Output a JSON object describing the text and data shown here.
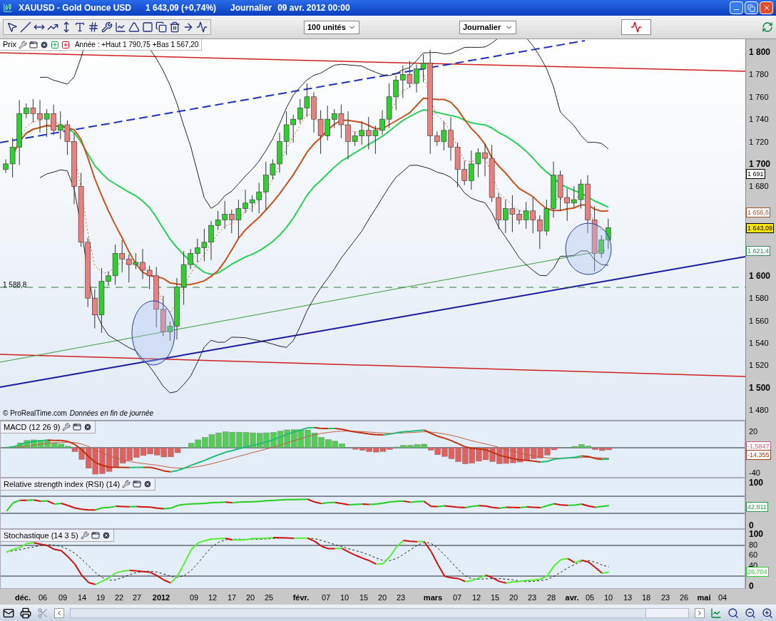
{
  "window": {
    "symbol": "XAUUSD - Gold Ounce USD",
    "quote": "1 643,09 (+0,74%)",
    "interval": "Journalier",
    "date": "09 avr. 2012 00:00"
  },
  "toolbar": {
    "quantity": "100 unités",
    "timeframe": "Journalier"
  },
  "price_panel": {
    "label": "Prix",
    "info": "Année : +Haut 1 790,75 +Bas 1 567,20",
    "level_label": "1 588,8",
    "credit": "© ProRealTime.com",
    "credit_note": "Données en fin de journée",
    "axis": [
      {
        "label": "1 800",
        "kind": "major"
      },
      {
        "label": "1 780",
        "kind": "minor"
      },
      {
        "label": "1 760",
        "kind": "minor"
      },
      {
        "label": "1 740",
        "kind": "minor"
      },
      {
        "label": "1 720",
        "kind": "minor"
      },
      {
        "label": "1 700",
        "kind": "major"
      },
      {
        "label": "1 680",
        "kind": "minor"
      },
      {
        "label": "1 600",
        "kind": "major"
      },
      {
        "label": "1 580",
        "kind": "minor"
      },
      {
        "label": "1 560",
        "kind": "minor"
      },
      {
        "label": "1 540",
        "kind": "minor"
      },
      {
        "label": "1 520",
        "kind": "minor"
      },
      {
        "label": "1 500",
        "kind": "major"
      },
      {
        "label": "1 480",
        "kind": "minor"
      }
    ],
    "markers": [
      {
        "label": "1 691",
        "color": "#000000",
        "kind": "plain"
      },
      {
        "label": "1 656,6",
        "color": "#a0522d",
        "kind": "plain"
      },
      {
        "label": "1 643,09",
        "color": "#000000",
        "kind": "current"
      },
      {
        "label": "1 621,4",
        "color": "#2e8b57",
        "kind": "plain"
      }
    ]
  },
  "indicators": [
    {
      "kind": "macd",
      "label": "MACD (12 26 9)",
      "axis": [
        {
          "label": "20",
          "kind": "minor"
        },
        {
          "label": "-40",
          "kind": "minor"
        }
      ],
      "markers": [
        {
          "label": "-1,5847",
          "color": "#c06080"
        },
        {
          "label": "-14,355",
          "color": "#a04020"
        }
      ]
    },
    {
      "kind": "rsi",
      "label": "Relative strength index (RSI) (14)",
      "axis": [
        {
          "label": "100",
          "kind": "major"
        },
        {
          "label": "0",
          "kind": "major"
        }
      ],
      "markers": [
        {
          "label": "42,811",
          "color": "#2e9e4e"
        }
      ]
    },
    {
      "kind": "stochastic",
      "label": "Stochastique (14 3 5)",
      "axis": [
        {
          "label": "100",
          "kind": "major"
        },
        {
          "label": "80",
          "kind": "minor"
        },
        {
          "label": "60",
          "kind": "minor"
        },
        {
          "label": "40",
          "kind": "minor"
        },
        {
          "label": "0",
          "kind": "major"
        }
      ],
      "markers": [
        {
          "label": "26,704",
          "color": "#33cc33"
        }
      ]
    }
  ],
  "dates": [
    {
      "label": "déc.",
      "kind": "month"
    },
    {
      "label": "06",
      "kind": "day"
    },
    {
      "label": "09",
      "kind": "day"
    },
    {
      "label": "14",
      "kind": "day"
    },
    {
      "label": "19",
      "kind": "day"
    },
    {
      "label": "22",
      "kind": "day"
    },
    {
      "label": "27",
      "kind": "day"
    },
    {
      "label": "2012",
      "kind": "month"
    },
    {
      "label": "09",
      "kind": "day"
    },
    {
      "label": "12",
      "kind": "day"
    },
    {
      "label": "17",
      "kind": "day"
    },
    {
      "label": "20",
      "kind": "day"
    },
    {
      "label": "25",
      "kind": "day"
    },
    {
      "label": "févr.",
      "kind": "month"
    },
    {
      "label": "07",
      "kind": "day"
    },
    {
      "label": "10",
      "kind": "day"
    },
    {
      "label": "15",
      "kind": "day"
    },
    {
      "label": "20",
      "kind": "day"
    },
    {
      "label": "23",
      "kind": "day"
    },
    {
      "label": "mars",
      "kind": "month"
    },
    {
      "label": "07",
      "kind": "day"
    },
    {
      "label": "12",
      "kind": "day"
    },
    {
      "label": "15",
      "kind": "day"
    },
    {
      "label": "20",
      "kind": "day"
    },
    {
      "label": "23",
      "kind": "day"
    },
    {
      "label": "28",
      "kind": "day"
    },
    {
      "label": "avr.",
      "kind": "month"
    },
    {
      "label": "05",
      "kind": "day"
    },
    {
      "label": "10",
      "kind": "day"
    },
    {
      "label": "13",
      "kind": "day"
    },
    {
      "label": "18",
      "kind": "day"
    },
    {
      "label": "23",
      "kind": "day"
    },
    {
      "label": "26",
      "kind": "day"
    },
    {
      "label": "mai",
      "kind": "month"
    },
    {
      "label": "04",
      "kind": "day"
    }
  ]
}
